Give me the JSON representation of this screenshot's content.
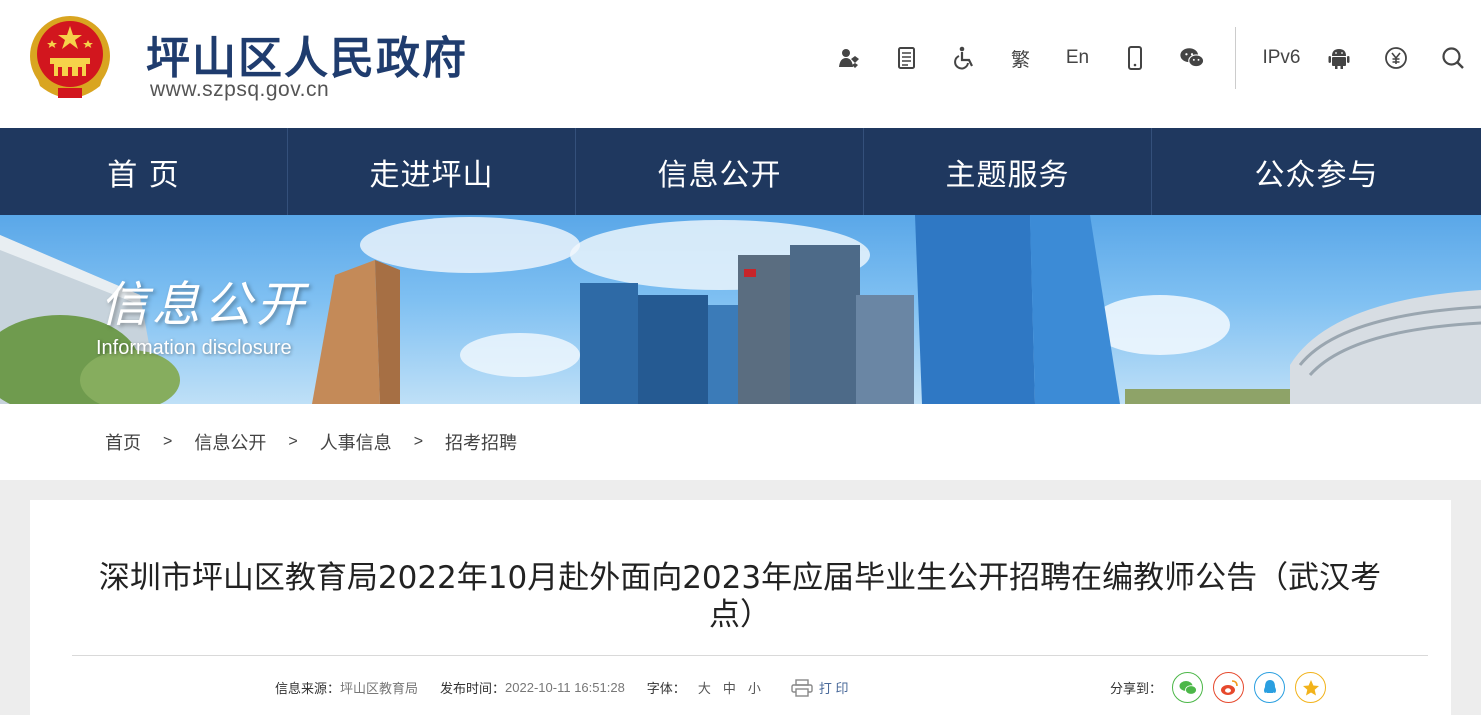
{
  "header": {
    "site_name": "坪山区人民政府",
    "site_url": "www.szpsq.gov.cn",
    "tools": {
      "traditional": "繁",
      "english": "En",
      "ipv6": "IPv6"
    }
  },
  "nav": {
    "items": [
      "首 页",
      "走进坪山",
      "信息公开",
      "主题服务",
      "公众参与"
    ]
  },
  "banner": {
    "title": "信息公开",
    "subtitle": "Information disclosure"
  },
  "breadcrumb": {
    "items": [
      "首页",
      "信息公开",
      "人事信息",
      "招考招聘"
    ],
    "separator": ">"
  },
  "article": {
    "title": "深圳市坪山区教育局2022年10月赴外面向2023年应届毕业生公开招聘在编教师公告（武汉考点）",
    "source_label": "信息来源：",
    "source_value": "坪山区教育局",
    "time_label": "发布时间：",
    "time_value": "2022-10-11 16:51:28",
    "font_label": "字体：",
    "font_large": "大",
    "font_medium": "中",
    "font_small": "小",
    "print_label": "打 印",
    "share_label": "分享到："
  },
  "colors": {
    "nav_bg": "#1f385f",
    "title_blue": "#1f3c6e",
    "wechat": "#4cb748",
    "weibo": "#e6492d",
    "qq": "#2a9fe0",
    "qzone": "#f2b31b"
  }
}
